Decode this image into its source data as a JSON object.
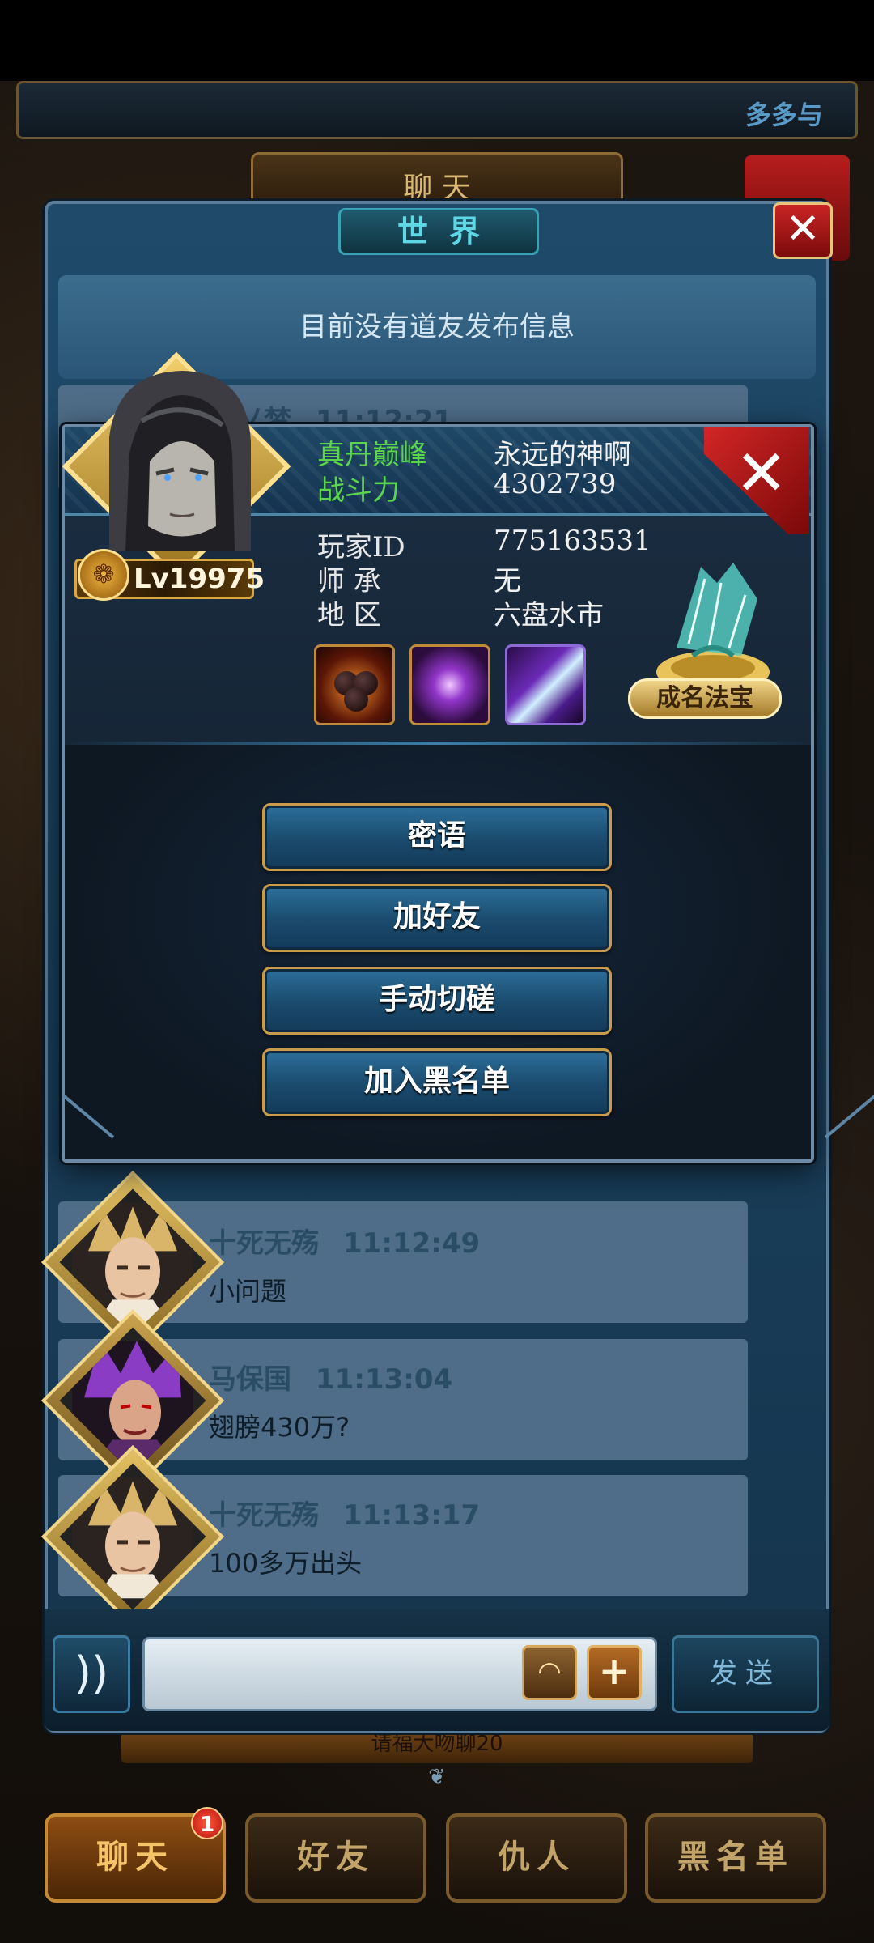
{
  "background": {
    "top_strip_text": "多多与",
    "title_plate": "聊 天",
    "tabs": [
      {
        "label": "聊天"
      },
      {
        "label": "好友"
      },
      {
        "label": "仇人"
      },
      {
        "label": "黑名单"
      }
    ],
    "chat_tab_badge": "1",
    "under_strip_text": "请福大吻聊20"
  },
  "world_panel": {
    "title": "世界",
    "notice": "目前没有道友发布信息",
    "partial_message": {
      "name": "仙乂梦",
      "time": "11:12:21"
    },
    "messages": [
      {
        "name": "十死无殇",
        "time": "11:12:49",
        "text": "小问题"
      },
      {
        "name": "马保国",
        "time": "11:13:04",
        "text": "翅膀430万?"
      },
      {
        "name": "十死无殇",
        "time": "11:13:17",
        "text": "100多万出头"
      }
    ],
    "input": {
      "value": "",
      "placeholder": ""
    },
    "send_label": "发送"
  },
  "player_popup": {
    "level": "Lv19975",
    "title": "真丹巅峰",
    "name": "永远的神啊",
    "power_label": "战斗力",
    "power_value": "4302739",
    "id_label": "玩家ID",
    "id_value": "775163531",
    "master_label": "师 承",
    "master_value": "无",
    "region_label": "地 区",
    "region_value": "六盘水市",
    "treasure_label": "成名法宝",
    "actions": [
      {
        "label": "密语"
      },
      {
        "label": "加好友"
      },
      {
        "label": "手动切磋"
      },
      {
        "label": "加入黑名单"
      }
    ]
  }
}
